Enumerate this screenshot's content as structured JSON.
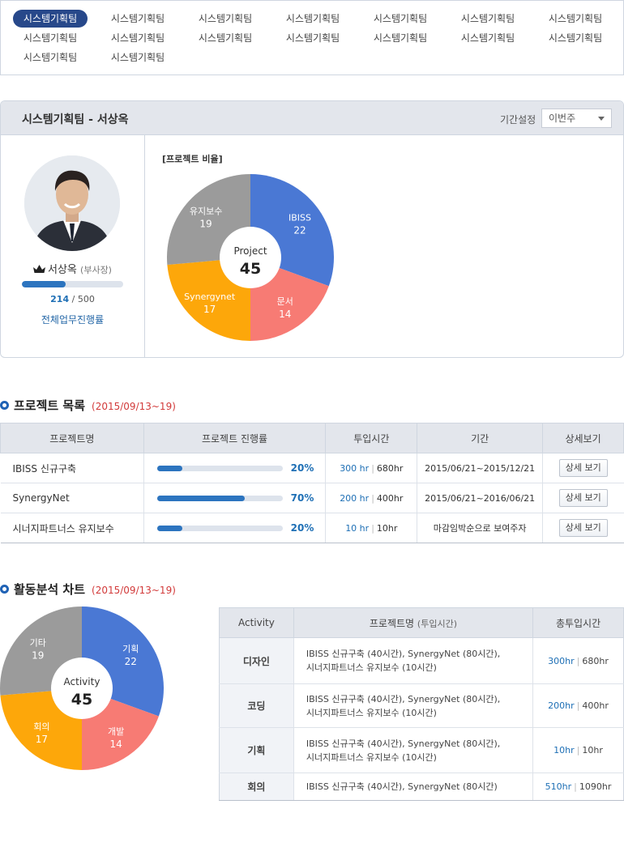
{
  "team_tabs": [
    "시스템기획팀",
    "시스템기획팀",
    "시스템기획팀",
    "시스템기획팀",
    "시스템기획팀",
    "시스템기획팀",
    "시스템기획팀",
    "시스템기획팀",
    "시스템기획팀",
    "시스템기획팀",
    "시스템기획팀",
    "시스템기획팀",
    "시스템기획팀",
    "시스템기획팀",
    "시스템기획팀",
    "시스템기획팀"
  ],
  "profile": {
    "title": "시스템기획팀  -  서상옥",
    "period_label": "기간설정",
    "period_value": "이번주",
    "name": "서상옥",
    "rank": "(부사장)",
    "progress_current": "214",
    "progress_total": "500",
    "progress_sep": " / ",
    "progress_fraction": 0.428,
    "progress_label": "전체업무진행률",
    "ratio_title": "[프로젝트 비율]"
  },
  "project_section": {
    "title": "프로젝트 목록",
    "date": "(2015/09/13~19)",
    "headers": [
      "프로젝트명",
      "프로젝트 진행률",
      "투입시간",
      "기간",
      "상세보기"
    ],
    "rows": [
      {
        "name": "IBISS 신규구축",
        "progress": 20,
        "progress_text": "20%",
        "used": "300 hr",
        "total": "680hr",
        "period": "2015/06/21~2015/12/21",
        "period_style": "red",
        "button": "상세 보기"
      },
      {
        "name": "SynergyNet",
        "progress": 70,
        "progress_text": "70%",
        "used": "200 hr",
        "total": "400hr",
        "period": "2015/06/21~2016/06/21",
        "period_style": "normal",
        "button": "상세 보기"
      },
      {
        "name": "시너지파트너스 유지보수",
        "progress": 20,
        "progress_text": "20%",
        "used": "10 hr",
        "total": "10hr",
        "period": "마감임박순으로 보여주자",
        "period_style": "gray",
        "button": "상세 보기"
      }
    ]
  },
  "activity_section": {
    "title": "활동분석 차트",
    "date": "(2015/09/13~19)",
    "headers": {
      "activity": "Activity",
      "project": "프로젝트명",
      "project_sub": "(투입시간)",
      "hours": "총투입시간"
    },
    "rows": [
      {
        "activity": "디자인",
        "projects": [
          "IBISS 신규구축 (40시간), SynergyNet (80시간),",
          "시너지파트너스 유지보수 (10시간)"
        ],
        "used": "300hr",
        "total": "680hr"
      },
      {
        "activity": "코딩",
        "projects": [
          "IBISS 신규구축 (40시간), SynergyNet (80시간),",
          "시너지파트너스 유지보수 (10시간)"
        ],
        "used": "200hr",
        "total": "400hr"
      },
      {
        "activity": "기획",
        "projects": [
          "IBISS 신규구축 (40시간), SynergyNet (80시간),",
          "시너지파트너스 유지보수 (10시간)"
        ],
        "used": "10hr",
        "total": "10hr"
      },
      {
        "activity": "회의",
        "projects": [
          "IBISS 신규구축 (40시간), SynergyNet (80시간)"
        ],
        "used": "510hr",
        "total": "1090hr"
      }
    ]
  },
  "chart_data": [
    {
      "type": "pie",
      "center_label": "Project",
      "center_value": "45",
      "slices": [
        {
          "name": "IBISS",
          "value": 22,
          "color": "#4a78d4"
        },
        {
          "name": "문서",
          "value": 14,
          "color": "#f77b74"
        },
        {
          "name": "Synergynet",
          "value": 17,
          "color": "#fda70a"
        },
        {
          "name": "유지보수",
          "value": 19,
          "color": "#9b9b9b"
        }
      ]
    },
    {
      "type": "pie",
      "center_label": "Activity",
      "center_value": "45",
      "slices": [
        {
          "name": "기획",
          "value": 22,
          "color": "#4a78d4"
        },
        {
          "name": "개발",
          "value": 14,
          "color": "#f77b74"
        },
        {
          "name": "회의",
          "value": 17,
          "color": "#fda70a"
        },
        {
          "name": "기타",
          "value": 19,
          "color": "#9b9b9b"
        }
      ]
    }
  ]
}
